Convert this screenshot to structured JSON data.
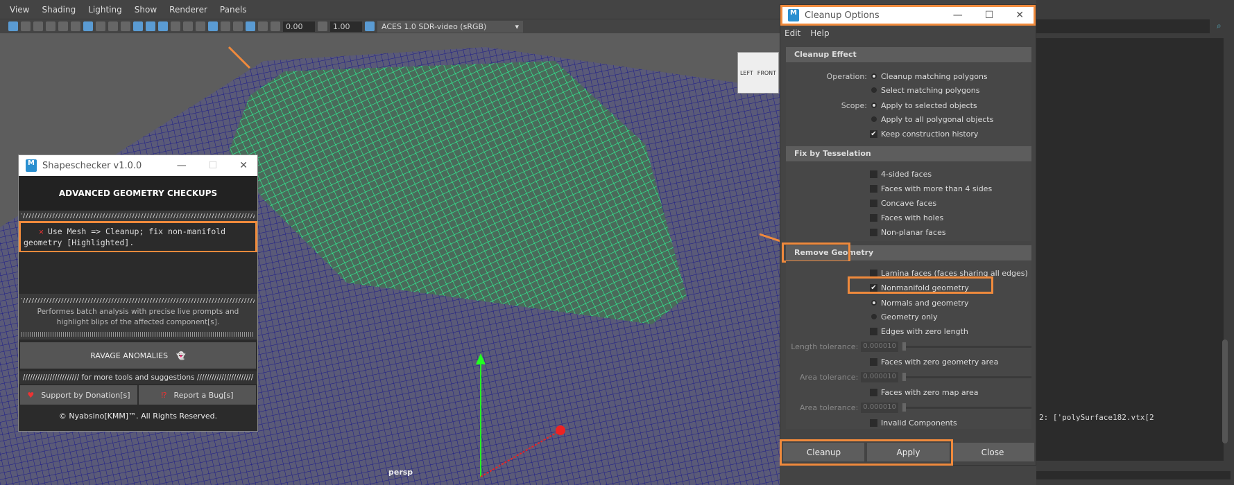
{
  "viewport": {
    "menu": [
      "View",
      "Shading",
      "Lighting",
      "Show",
      "Renderer",
      "Panels"
    ],
    "exposure": "0.00",
    "gamma": "1.00",
    "colorspace": "ACES 1.0 SDR-video (sRGB)",
    "camera_label": "persp",
    "viewcube": [
      "LEFT",
      "FRONT"
    ]
  },
  "shapeschecker": {
    "title": "Shapeschecker v1.0.0",
    "header": "ADVANCED GEOMETRY CHECKUPS",
    "message": "Use Mesh => Cleanup; fix non-manifold geometry [Highlighted].",
    "description": "Performes batch analysis with precise live prompts and highlight blips of the affected component[s].",
    "run_button": "RAVAGE ANOMALIES",
    "links_caption": "/////////////////////// for more tools and suggestions ///////////////////////",
    "donate_button": "Support by Donation[s]",
    "bug_button": "Report a Bug[s]",
    "footer": "© Nyabsino[KMM]™. All Rights Reserved."
  },
  "cleanup": {
    "title": "Cleanup Options",
    "menu": [
      "Edit",
      "Help"
    ],
    "effect": {
      "header": "Cleanup Effect",
      "operation_label": "Operation:",
      "op1": "Cleanup matching polygons",
      "op2": "Select matching polygons",
      "scope_label": "Scope:",
      "scope1": "Apply to selected objects",
      "scope2": "Apply to all polygonal objects",
      "history": "Keep construction history"
    },
    "tess": {
      "header": "Fix by Tesselation",
      "items": [
        "4-sided faces",
        "Faces with more than 4 sides",
        "Concave faces",
        "Faces with holes",
        "Non-planar faces"
      ]
    },
    "remove": {
      "header": "Remove Geometry",
      "lamina": "Lamina faces (faces sharing all edges)",
      "nonmanifold": "Nonmanifold geometry",
      "normals": "Normals and geometry",
      "geomonly": "Geometry only",
      "zero_edges": "Edges with zero length",
      "length_tol_label": "Length tolerance:",
      "length_tol": "0.000010",
      "zero_area": "Faces with zero geometry area",
      "area_tol_label": "Area tolerance:",
      "area_tol": "0.000010",
      "zero_map": "Faces with zero map area",
      "map_tol_label": "Area tolerance:",
      "map_tol": "0.000010",
      "invalid": "Invalid Components"
    },
    "buttons": {
      "cleanup": "Cleanup",
      "apply": "Apply",
      "close": "Close"
    }
  },
  "script_editor": {
    "output": "2: ['polySurface182.vtx[2"
  }
}
